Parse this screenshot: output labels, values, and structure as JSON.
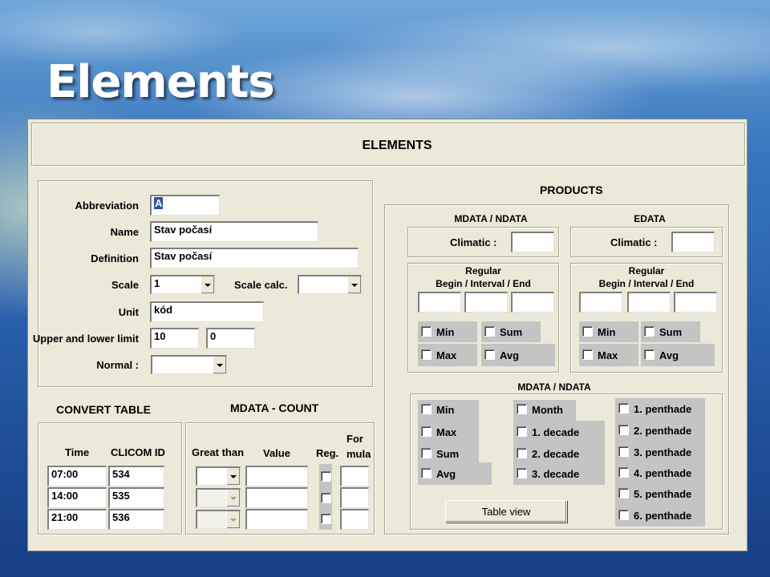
{
  "slide": {
    "title": "Elements"
  },
  "window": {
    "title": "ELEMENTS"
  },
  "element_form": {
    "abbreviation": {
      "label": "Abbreviation",
      "value": "A"
    },
    "name": {
      "label": "Name",
      "value": "Stav počasí"
    },
    "definition": {
      "label": "Definition",
      "value": "Stav počasí"
    },
    "scale": {
      "label": "Scale",
      "value": "1"
    },
    "scale_calc": {
      "label": "Scale calc.",
      "value": ""
    },
    "unit": {
      "label": "Unit",
      "value": "kód"
    },
    "limits": {
      "label": "Upper and lower limit",
      "upper": "10",
      "lower": "0"
    },
    "normal": {
      "label": "Normal :",
      "value": ""
    }
  },
  "convert_table": {
    "heading": "CONVERT TABLE",
    "columns": [
      "Time",
      "CLICOM ID"
    ],
    "rows": [
      {
        "time": "07:00",
        "id": "534"
      },
      {
        "time": "14:00",
        "id": "535"
      },
      {
        "time": "21:00",
        "id": "536"
      }
    ]
  },
  "mdata_count": {
    "heading": "MDATA - COUNT",
    "columns": [
      "Great than",
      "Value",
      "Reg.",
      "For",
      "mula"
    ],
    "rows": [
      {
        "great_than": "",
        "value": "",
        "formula": ""
      },
      {
        "great_than": "",
        "value": "",
        "formula": ""
      },
      {
        "great_than": "",
        "value": "",
        "formula": ""
      }
    ]
  },
  "products": {
    "heading": "PRODUCTS",
    "mdata_ndata": {
      "heading": "MDATA / NDATA",
      "climatic_label": "Climatic :",
      "climatic_value": "",
      "regular_title": "Regular",
      "regular_sub": "Begin / Interval / End",
      "stats": [
        "Min",
        "Sum",
        "Max",
        "Avg"
      ]
    },
    "edata": {
      "heading": "EDATA",
      "climatic_label": "Climatic :",
      "climatic_value": "",
      "regular_title": "Regular",
      "regular_sub": "Begin / Interval / End",
      "stats": [
        "Min",
        "Sum",
        "Max",
        "Avg"
      ]
    },
    "lower": {
      "heading": "MDATA / NDATA",
      "col1": [
        "Min",
        "Max",
        "Sum",
        "Avg"
      ],
      "col2": [
        "Month",
        "1. decade",
        "2. decade",
        "3. decade"
      ],
      "col3": [
        "1. penthade",
        "2. penthade",
        "3. penthade",
        "4. penthade",
        "5. penthade",
        "6. penthade"
      ],
      "table_view_button": "Table view"
    }
  },
  "colors": {
    "window_bg": "#ece9d8",
    "checkbox_band": "#c4c4c4",
    "selection": "#2f4fa8"
  }
}
